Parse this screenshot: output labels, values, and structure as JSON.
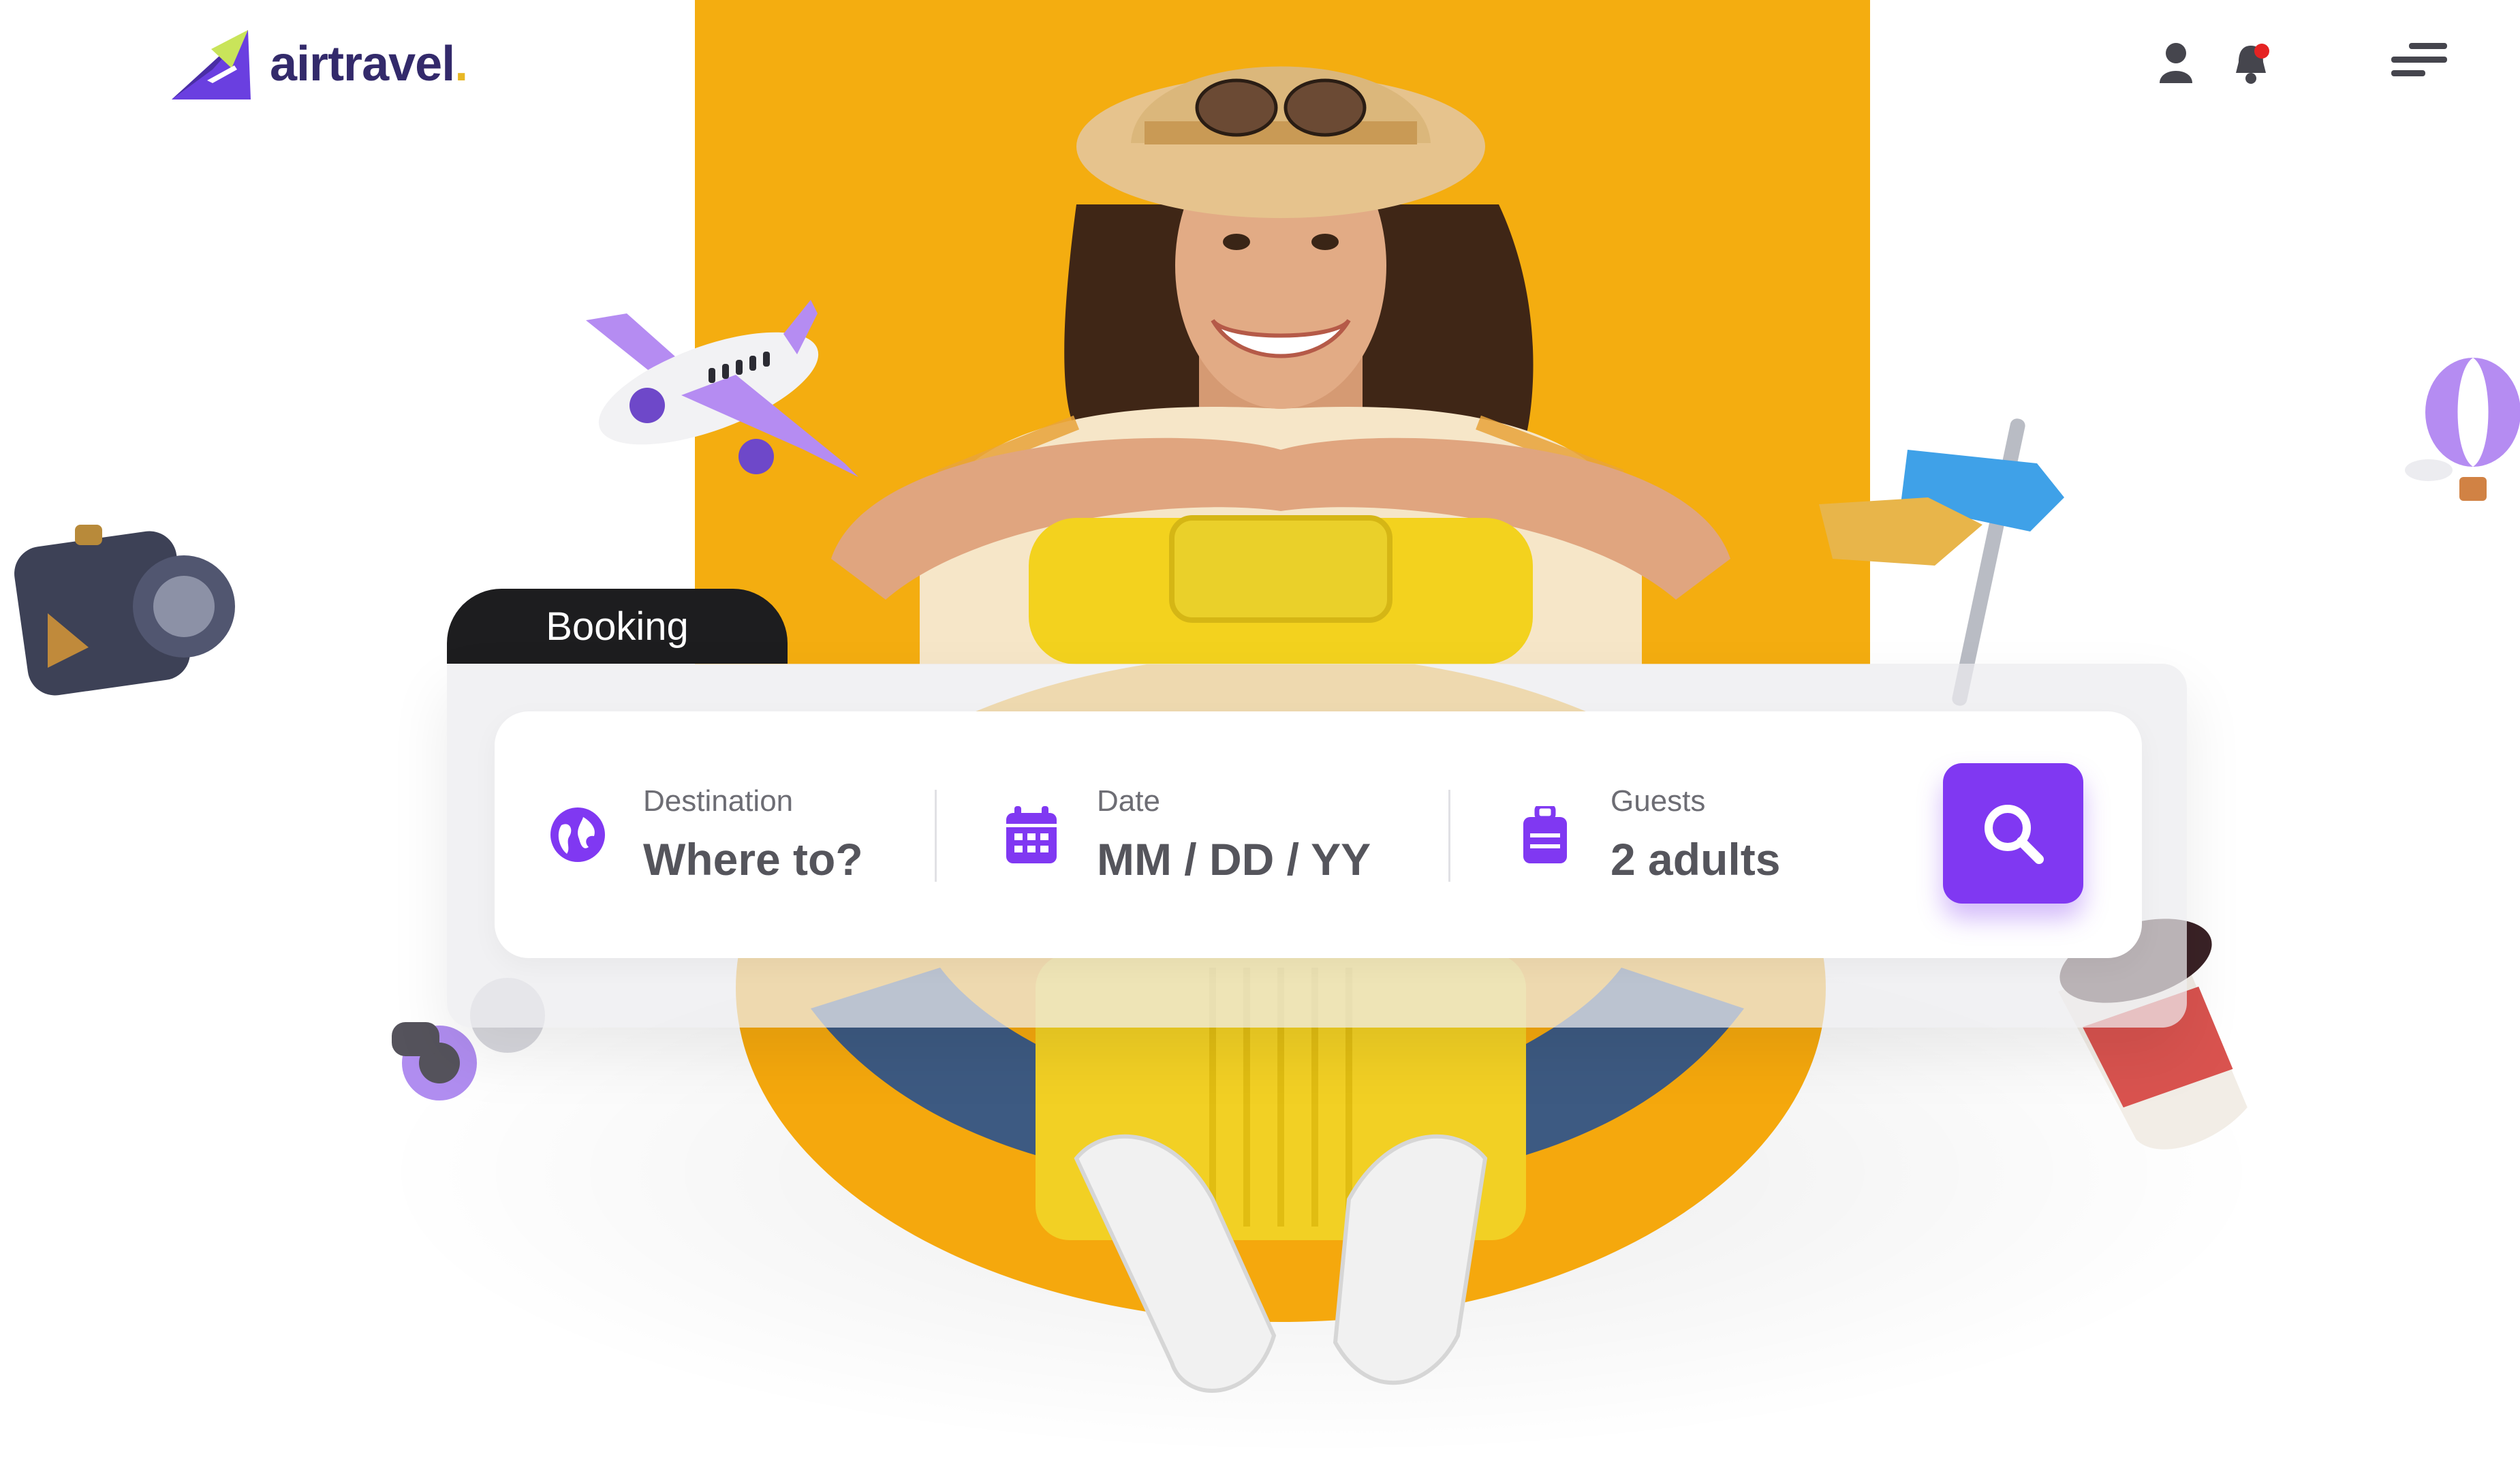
{
  "brand": {
    "name": "airtravel",
    "dot": "."
  },
  "header": {
    "icons": [
      "user-icon",
      "bell-icon",
      "menu-icon"
    ],
    "notification_dot_color": "#e52323"
  },
  "booking": {
    "tab_label": "Booking",
    "fields": [
      {
        "label": "Destination",
        "value": "Where to?",
        "icon": "globe-icon"
      },
      {
        "label": "Date",
        "value": "MM / DD / YY",
        "icon": "calendar-icon"
      },
      {
        "label": "Guests",
        "value": "2 adults",
        "icon": "luggage-icon"
      }
    ],
    "search_icon": "search-icon"
  },
  "colors": {
    "accent": "#8038f2",
    "hero_background": "#f4ad10",
    "brand_navy": "#332a6b",
    "brand_yellow": "#e8b724",
    "tab": "#1d1d1f"
  },
  "decorations": [
    "airplane-icon",
    "camera-icon",
    "binoculars-icon",
    "signpost-icon",
    "hot-air-balloon-icon",
    "coffee-cup-icon"
  ]
}
